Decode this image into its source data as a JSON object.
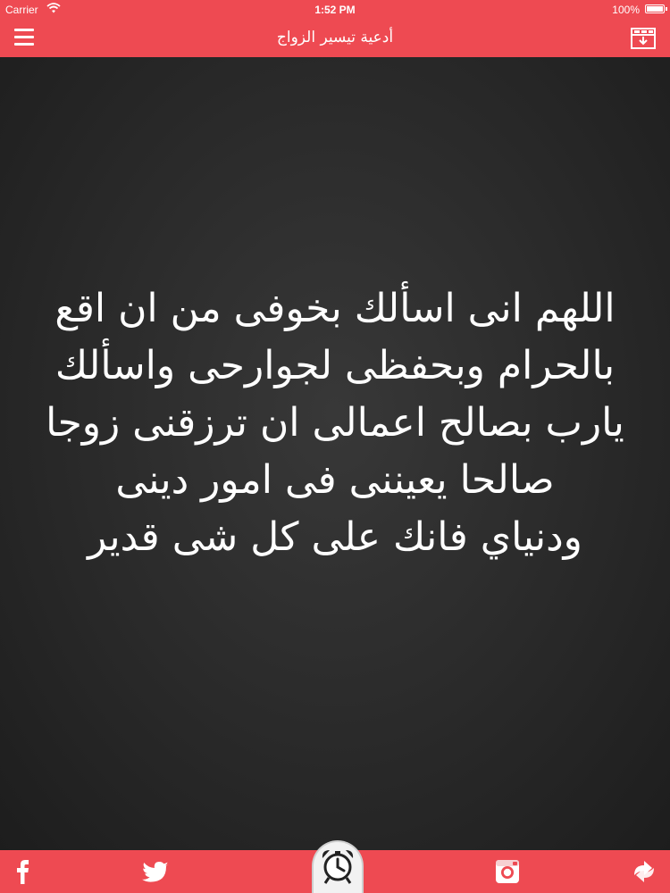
{
  "status_bar": {
    "carrier": "Carrier",
    "time": "1:52 PM",
    "battery": "100%",
    "battery_level": 1.0
  },
  "navbar": {
    "title": "أدعية تيسير الزواج",
    "left_icon": "menu-icon",
    "right_icon": "save-download-icon"
  },
  "content": {
    "prayer_lines": [
      "اللهم انى اسألك بخوفى من ان اقع",
      "بالحرام وبحفظى لجوارحى واسألك",
      "يارب بصالح اعمالى ان ترزقنى زوجا",
      "صالحا يعيننى فى امور دينى",
      "ودنياي فانك على كل شى قدير"
    ]
  },
  "bottom_bar": {
    "icons": [
      "facebook-icon",
      "twitter-icon",
      "alarm-clock-icon",
      "instagram-icon",
      "share-icon"
    ]
  },
  "colors": {
    "accent": "#ee4a52",
    "board": "#2c2c2c",
    "text": "#ffffff"
  }
}
